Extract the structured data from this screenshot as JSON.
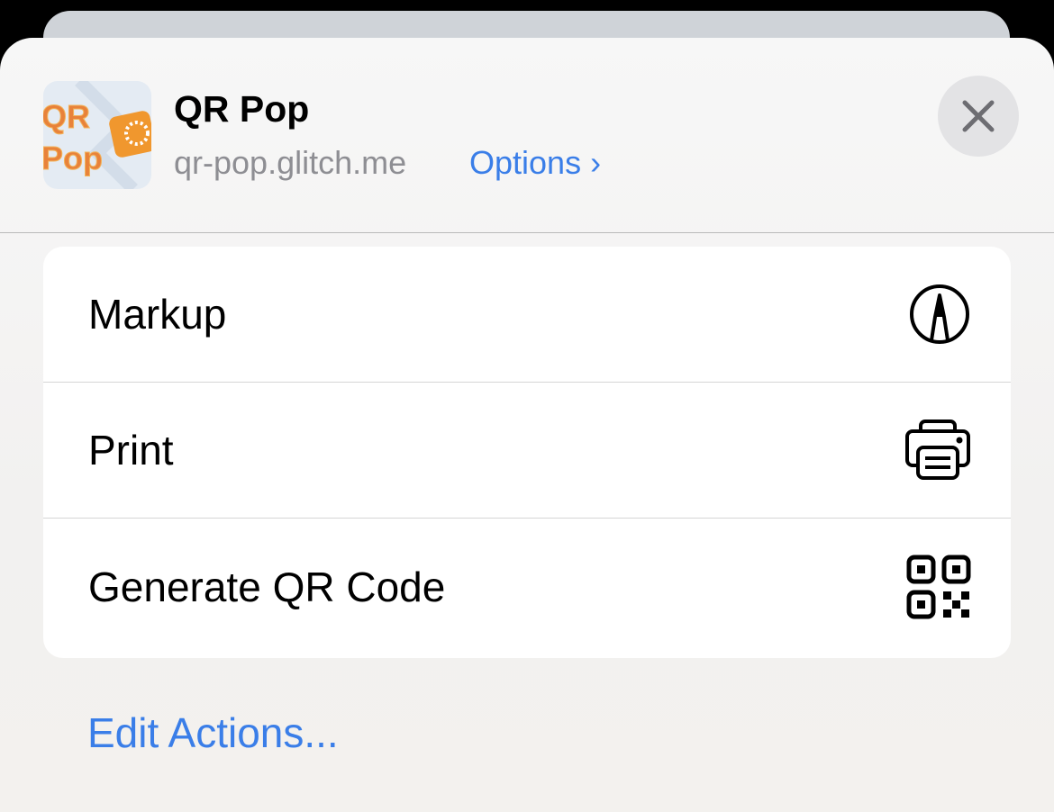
{
  "header": {
    "app_name": "QR Pop",
    "url": "qr-pop.glitch.me",
    "options_label": "Options",
    "options_chevron": "›",
    "icon_text": [
      "QR",
      "Pop"
    ]
  },
  "actions": [
    {
      "label": "Markup",
      "icon": "markup-icon"
    },
    {
      "label": "Print",
      "icon": "printer-icon"
    },
    {
      "label": "Generate QR Code",
      "icon": "qr-code-icon"
    }
  ],
  "edit_actions_label": "Edit Actions...",
  "colors": {
    "accent": "#3a7ee8",
    "secondary_text": "#8e8e93"
  }
}
